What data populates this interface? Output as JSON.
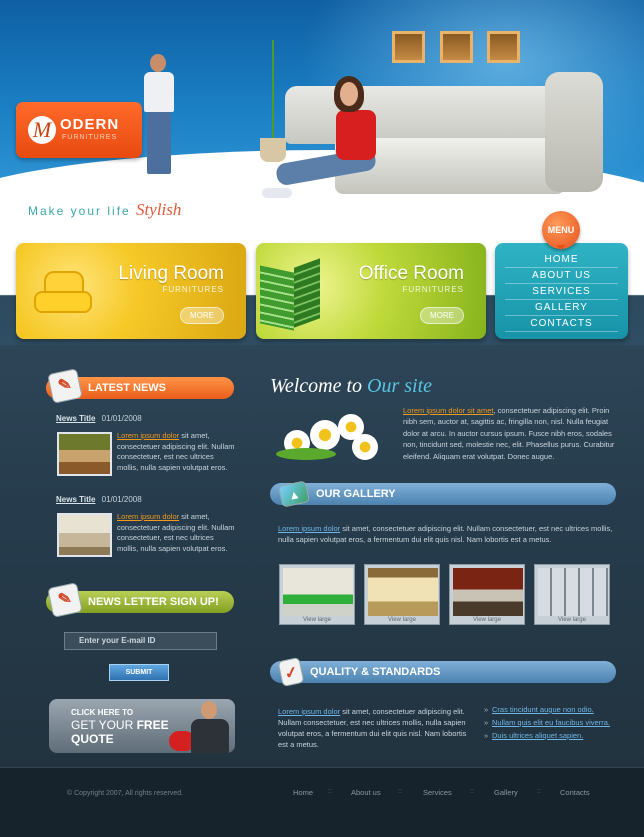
{
  "logo": {
    "mark": "M",
    "name": "ODERN",
    "sub": "FURNITURES"
  },
  "tagline": {
    "text": "Make your life",
    "accent": "Stylish"
  },
  "cards": [
    {
      "title": "Living Room",
      "sub": "FURNITURES",
      "button": "MORE"
    },
    {
      "title": "Office Room",
      "sub": "FURNITURES",
      "button": "MORE"
    }
  ],
  "menu": {
    "badge": "MENU",
    "items": [
      "HOME",
      "ABOUT US",
      "SERVICES",
      "GALLERY",
      "CONTACTS"
    ]
  },
  "latest_news": {
    "heading": "LATEST NEWS",
    "items": [
      {
        "title": "News Title",
        "date": "01/01/2008",
        "link": "Lorem ipsum dolor",
        "text": "sit amet, consectetuer adipiscing elit. Nullam consectetuer, est nec ultrices mollis, nulla sapien volutpat eros."
      },
      {
        "title": "News Title",
        "date": "01/01/2008",
        "link": "Lorem ipsum dolor",
        "text": "sit amet, consectetuer adipiscing elit. Nullam consectetuer, est nec ultrices mollis, nulla sapien volutpat eros."
      }
    ]
  },
  "newsletter": {
    "heading": "NEWS LETTER SIGN UP!",
    "email_placeholder": "Enter your E-mail ID",
    "submit": "SUBMIT"
  },
  "quote_banner": {
    "line1": "CLICK HERE TO",
    "line2": "GET YOUR",
    "line2_bold": "FREE",
    "line3": "QUOTE"
  },
  "welcome": {
    "title": "Welcome to",
    "title_accent": "Our site",
    "link": "Lorem ipsum dolor sit amet",
    "text": ", consectetuer adipiscing elit. Proin nibh sem, auctor at, sagittis ac, fringilla non, nisl. Nulla feugiat dolor at arcu. In auctor cursus ipsum. Fusce nibh eros, sodales non, tincidunt sed, molestie nec, elit. Phasellus purus. Curabitur eleifend. Aliquam erat volutpat. Donec augue."
  },
  "gallery": {
    "heading": "OUR GALLERY",
    "link": "Lorem ipsum dolor",
    "text": " sit amet, consectetuer adipiscing elit. Nullam consectetuer, est nec ultrices mollis, nulla sapien volutpat eros, a fermentum dui elit quis nisl. Nam lobortis est a metus.",
    "thumbs": [
      {
        "caption": "View large",
        "colors": [
          "#e8e6da",
          "#2fae3a"
        ]
      },
      {
        "caption": "View large",
        "colors": [
          "#f1e2b6",
          "#b89a5a"
        ]
      },
      {
        "caption": "View large",
        "colors": [
          "#7a2414",
          "#c9c3b6"
        ]
      },
      {
        "caption": "View large",
        "colors": [
          "#d7dce2",
          "#7d8791"
        ]
      }
    ]
  },
  "quality": {
    "heading": "QUALITY & STANDARDS",
    "link": "Lorem ipsum dolor",
    "text": " sit amet, consectetuer adipiscing elit. Nullam consectetuer, est nec ultrices mollis, nulla sapien volutpat eros, a fermentum dui elit quis nisl. Nam lobortis est a metus.",
    "links": [
      "Cras tincidunt augue non odio.",
      "Nullam quis elit eu faucibus viverra.",
      "Duis ultrices aliquet sapien."
    ]
  },
  "footer": {
    "copyright": "© Copyright 2007, All rights reserved.",
    "nav": [
      "Home",
      "About us",
      "Services",
      "Gallery",
      "Contacts"
    ],
    "separator": "::"
  },
  "colors": {
    "accent_orange": "#ea5e1a",
    "accent_blue": "#1b7fc4",
    "menu_teal": "#1793a8",
    "link_orange": "#f39a1c",
    "link_blue": "#6fb6e8"
  }
}
